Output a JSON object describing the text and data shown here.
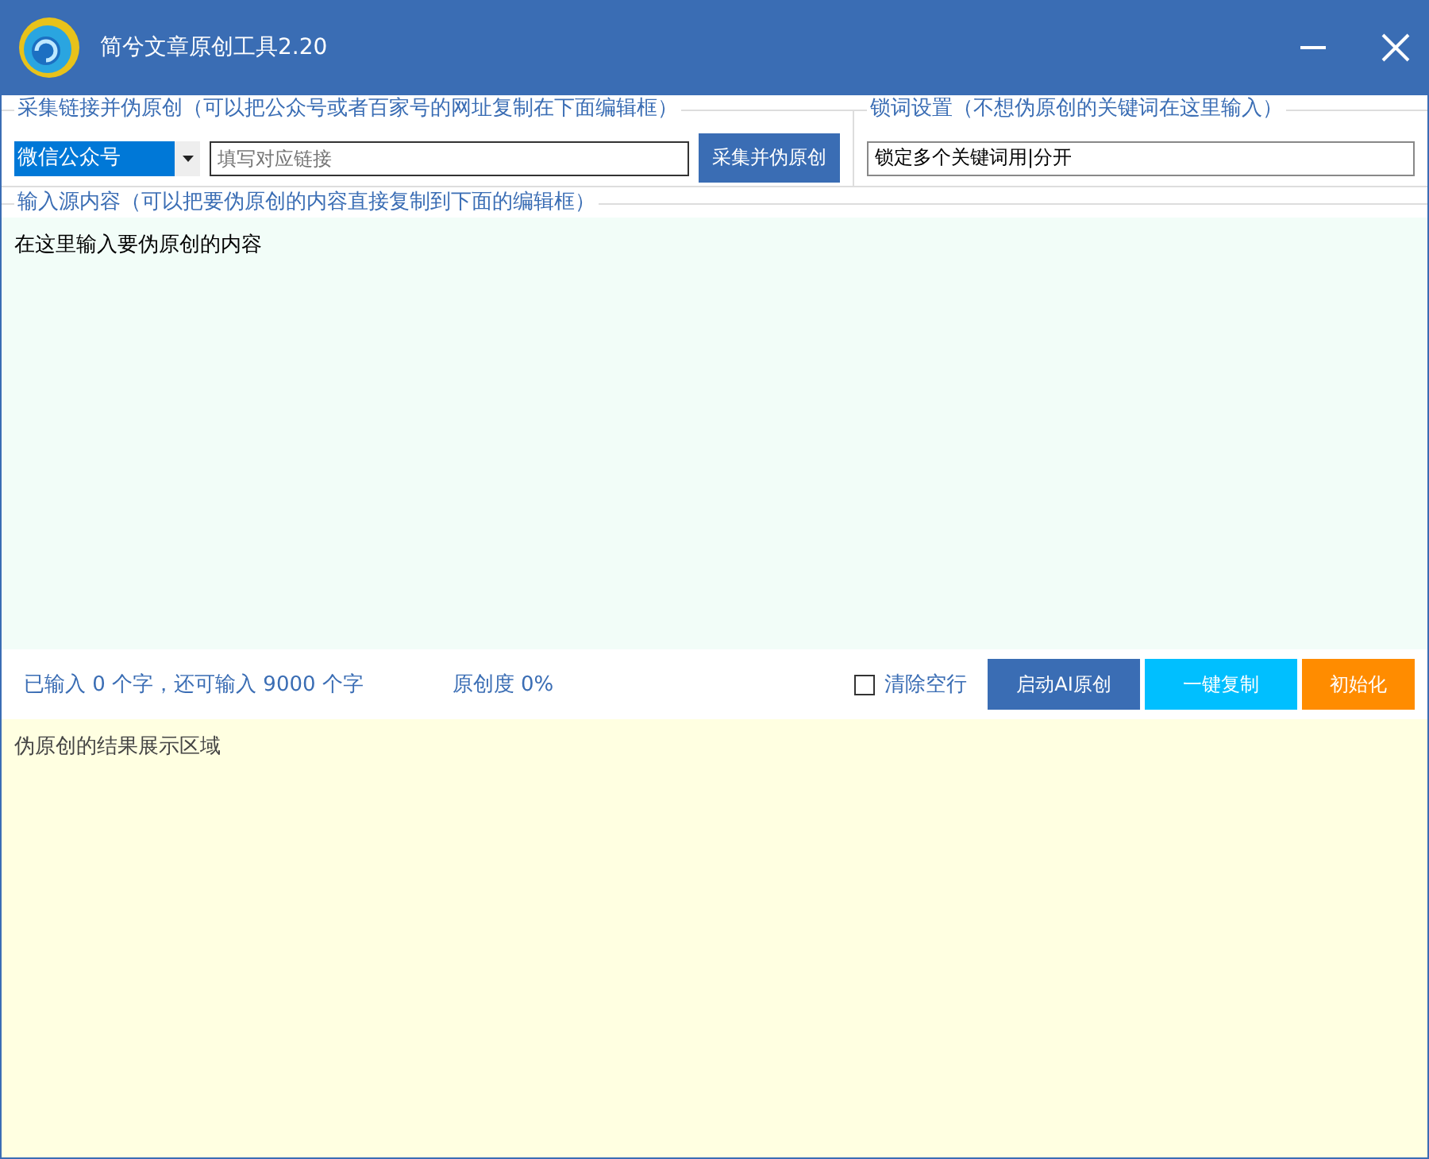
{
  "window": {
    "title": "简兮文章原创工具2.20"
  },
  "collect": {
    "legend": "采集链接并伪原创（可以把公众号或者百家号的网址复制在下面编辑框）",
    "source": "微信公众号",
    "link_placeholder": "填写对应链接",
    "button": "采集并伪原创"
  },
  "lock": {
    "legend": "锁词设置（不想伪原创的关键词在这里输入）",
    "value": "锁定多个关键词用|分开"
  },
  "input": {
    "legend": "输入源内容（可以把要伪原创的内容直接复制到下面的编辑框）",
    "value": "在这里输入要伪原创的内容"
  },
  "status": {
    "count": "已输入 0 个字，还可输入 9000 个字",
    "originality": "原创度 0%"
  },
  "clear_blank_lines": {
    "label": "清除空行",
    "checked": false
  },
  "buttons": [
    {
      "label": "启动AI原创",
      "kind": "primary"
    },
    {
      "label": "一键复制",
      "kind": "copy"
    },
    {
      "label": "初始化",
      "kind": "reset"
    }
  ],
  "result": {
    "value": "伪原创的结果展示区域"
  }
}
